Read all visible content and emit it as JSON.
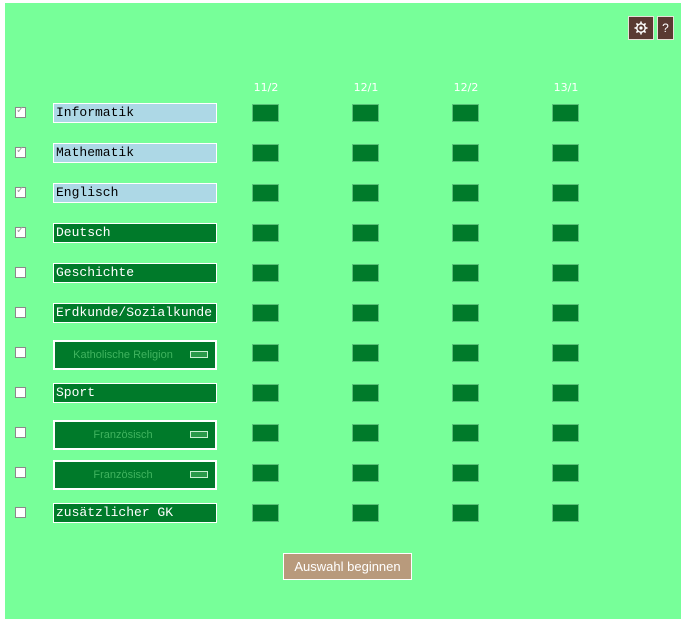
{
  "header": {
    "settings_icon": "gear-icon",
    "help_label": "?"
  },
  "columns": [
    "11/2",
    "12/1",
    "12/2",
    "13/1"
  ],
  "subjects": [
    {
      "label": "Informatik",
      "checked": true,
      "style": "light"
    },
    {
      "label": "Mathematik",
      "checked": true,
      "style": "light"
    },
    {
      "label": "Englisch",
      "checked": true,
      "style": "light"
    },
    {
      "label": "Deutsch",
      "checked": true,
      "style": "dark"
    },
    {
      "label": "Geschichte",
      "checked": false,
      "style": "dark"
    },
    {
      "label": "Erdkunde/Sozialkunde",
      "checked": false,
      "style": "dark"
    },
    {
      "label": "Katholische Religion",
      "checked": false,
      "style": "select"
    },
    {
      "label": "Sport",
      "checked": false,
      "style": "dark"
    },
    {
      "label": "Französisch",
      "checked": false,
      "style": "select"
    },
    {
      "label": "Französisch",
      "checked": false,
      "style": "select"
    },
    {
      "label": "zusätzlicher GK",
      "checked": false,
      "style": "dark"
    }
  ],
  "start_button_label": "Auswahl beginnen",
  "colors": {
    "background": "#77ff99",
    "cell": "#007a2a",
    "field_light": "#add8e6",
    "button": "#b89a7c"
  }
}
